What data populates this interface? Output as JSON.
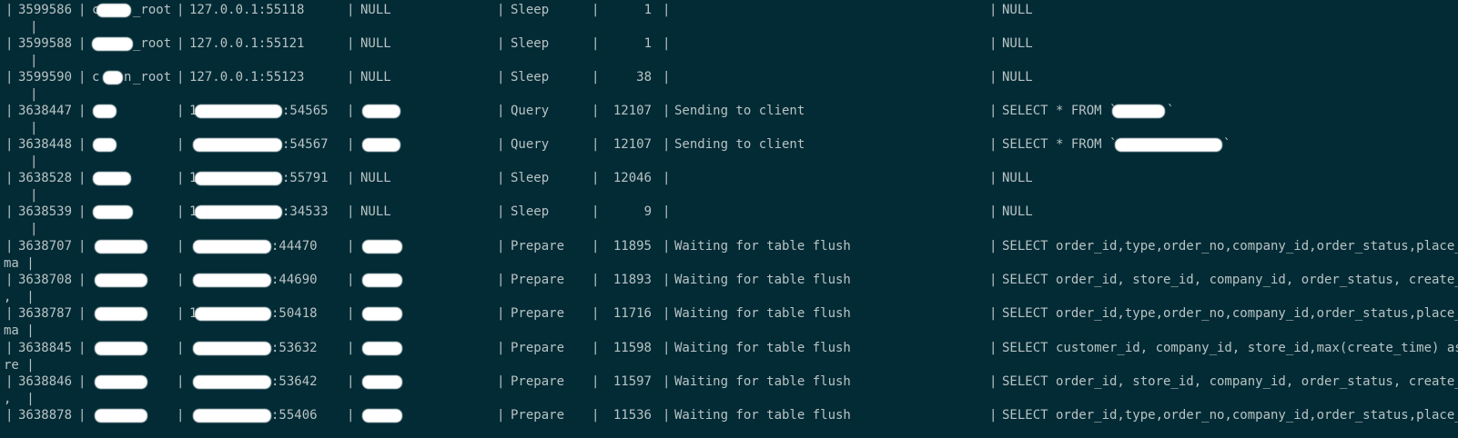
{
  "rows": [
    {
      "id": "3599586",
      "user": "_root",
      "host": "127.0.0.1:55118",
      "db": "NULL",
      "command": "Sleep",
      "time": "1",
      "state": "",
      "info": "NULL",
      "wrap": "|"
    },
    {
      "id": "3599588",
      "user": "_root",
      "host": "127.0.0.1:55121",
      "db": "NULL",
      "command": "Sleep",
      "time": "1",
      "state": "",
      "info": "NULL",
      "wrap": "|"
    },
    {
      "id": "3599590",
      "user": "_root",
      "host": "127.0.0.1:55123",
      "db": "NULL",
      "command": "Sleep",
      "time": "38",
      "state": "",
      "info": "NULL",
      "wrap": "|"
    },
    {
      "id": "3638447",
      "user": "",
      "host": ":54565",
      "db": "",
      "command": "Query",
      "time": "12107",
      "state": "Sending to client",
      "info": "SELECT * FROM `",
      "wrap": "|"
    },
    {
      "id": "3638448",
      "user": "",
      "host": ":54567",
      "db": "",
      "command": "Query",
      "time": "12107",
      "state": "Sending to client",
      "info": "SELECT * FROM `",
      "wrap": "|"
    },
    {
      "id": "3638528",
      "user": "",
      "host": ":55791",
      "db": "NULL",
      "command": "Sleep",
      "time": "12046",
      "state": "",
      "info": "NULL",
      "wrap": "|"
    },
    {
      "id": "3638539",
      "user": "",
      "host": ":34533",
      "db": "NULL",
      "command": "Sleep",
      "time": "9",
      "state": "",
      "info": "NULL",
      "wrap": "|"
    },
    {
      "id": "3638707",
      "user": "",
      "host": ":44470",
      "db": "",
      "command": "Prepare",
      "time": "11895",
      "state": "Waiting for table flush",
      "info": "SELECT order_id,type,order_no,company_id,order_status,place_",
      "wrap": "ma |"
    },
    {
      "id": "3638708",
      "user": "",
      "host": ":44690",
      "db": "",
      "command": "Prepare",
      "time": "11893",
      "state": "Waiting for table flush",
      "info": "SELECT order_id, store_id, company_id, order_status, create_",
      "wrap": ",  |"
    },
    {
      "id": "3638787",
      "user": "",
      "host": ":50418",
      "db": "",
      "command": "Prepare",
      "time": "11716",
      "state": "Waiting for table flush",
      "info": "SELECT order_id,type,order_no,company_id,order_status,place_",
      "wrap": "ma |"
    },
    {
      "id": "3638845",
      "user": "",
      "host": ":53632",
      "db": "",
      "command": "Prepare",
      "time": "11598",
      "state": "Waiting for table flush",
      "info": "SELECT customer_id, company_id, store_id,max(create_time) as",
      "wrap": "re |"
    },
    {
      "id": "3638846",
      "user": "",
      "host": ":53642",
      "db": "",
      "command": "Prepare",
      "time": "11597",
      "state": "Waiting for table flush",
      "info": "SELECT order_id, store_id, company_id, order_status, create_",
      "wrap": ",  |"
    },
    {
      "id": "3638878",
      "user": "",
      "host": ":55406",
      "db": "",
      "command": "Prepare",
      "time": "11536",
      "state": "Waiting for table flush",
      "info": "SELECT order_id,type,order_no,company_id,order_status,place_",
      "wrap": ""
    }
  ]
}
